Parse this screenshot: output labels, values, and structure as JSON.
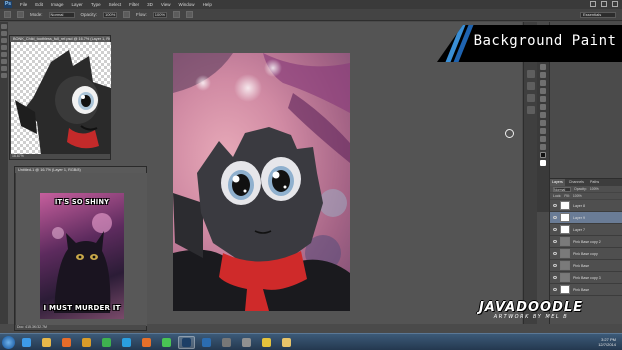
{
  "app": {
    "name": "Photoshop",
    "logo_text": "Ps"
  },
  "menubar": {
    "items": [
      "File",
      "Edit",
      "Image",
      "Layer",
      "Type",
      "Select",
      "Filter",
      "3D",
      "View",
      "Window",
      "Help"
    ]
  },
  "optionsbar": {
    "mode_label": "Mode:",
    "mode_value": "Normal",
    "opacity_label": "Opacity:",
    "opacity_value": "100%",
    "flow_label": "Flow:",
    "flow_value": "100%",
    "workspace_value": "Essentials"
  },
  "documents": [
    {
      "title": "BONK_Child_toothless_full_ref.psd @ 16.7% (Layer 1, RGB/8)",
      "status": "16.67%"
    },
    {
      "title": "Untitled-1 @ 16.7% (Layer 1, RGB/8)",
      "status": "Doc: 415.3K/32.7M",
      "meme_top": "IT'S SO SHINY",
      "meme_bottom": "I MUST MURDER IT"
    }
  ],
  "status_bar": {
    "zoom": "16.67%",
    "doc_size": "Doc: 48.0M/96.1M"
  },
  "banner": {
    "text": "Background Paint",
    "stripe_colors": [
      "#3a8fd6",
      "#1e63b0"
    ]
  },
  "watermark": {
    "main": "JAVADOODLE",
    "sub": "ARTWORK BY MEL B"
  },
  "layers_panel": {
    "tabs": [
      "Layers",
      "Channels",
      "Paths"
    ],
    "blend_mode": "Normal",
    "opacity_label": "Opacity:",
    "opacity_value": "100%",
    "lock_label": "Lock:",
    "fill_label": "Fill:",
    "fill_value": "100%",
    "layers": [
      {
        "name": "Layer 8",
        "selected": false
      },
      {
        "name": "Layer 9",
        "selected": true
      },
      {
        "name": "Layer 7",
        "selected": false
      },
      {
        "name": "Pink Base copy 2",
        "selected": false
      },
      {
        "name": "Pink Base copy",
        "selected": false
      },
      {
        "name": "Pink Base",
        "selected": false
      },
      {
        "name": "Pink Base copy 3",
        "selected": false
      },
      {
        "name": "Pink Base",
        "selected": false
      }
    ]
  },
  "taskbar": {
    "apps": [
      {
        "icon": "ie-icon",
        "color": "#3d9be9"
      },
      {
        "icon": "folder-icon",
        "color": "#e8b84a"
      },
      {
        "icon": "media-icon",
        "color": "#e56c2a"
      },
      {
        "icon": "ln-icon",
        "color": "#d99c2a"
      },
      {
        "icon": "globe-icon",
        "color": "#3eb24f"
      },
      {
        "icon": "skype-icon",
        "color": "#2a9fe0"
      },
      {
        "icon": "firefox-icon",
        "color": "#e5702a"
      },
      {
        "icon": "spotify-icon",
        "color": "#49c454"
      },
      {
        "icon": "photoshop-icon",
        "color": "#1d3f66"
      },
      {
        "icon": "ps-icon",
        "color": "#2b6cb0"
      },
      {
        "icon": "camera-icon",
        "color": "#777777"
      },
      {
        "icon": "pen-icon",
        "color": "#909090"
      },
      {
        "icon": "chrome-icon",
        "color": "#e4c23c"
      },
      {
        "icon": "explorer-icon",
        "color": "#e8c46a"
      }
    ],
    "time": "3:27 PM",
    "date": "12/7/2014"
  }
}
